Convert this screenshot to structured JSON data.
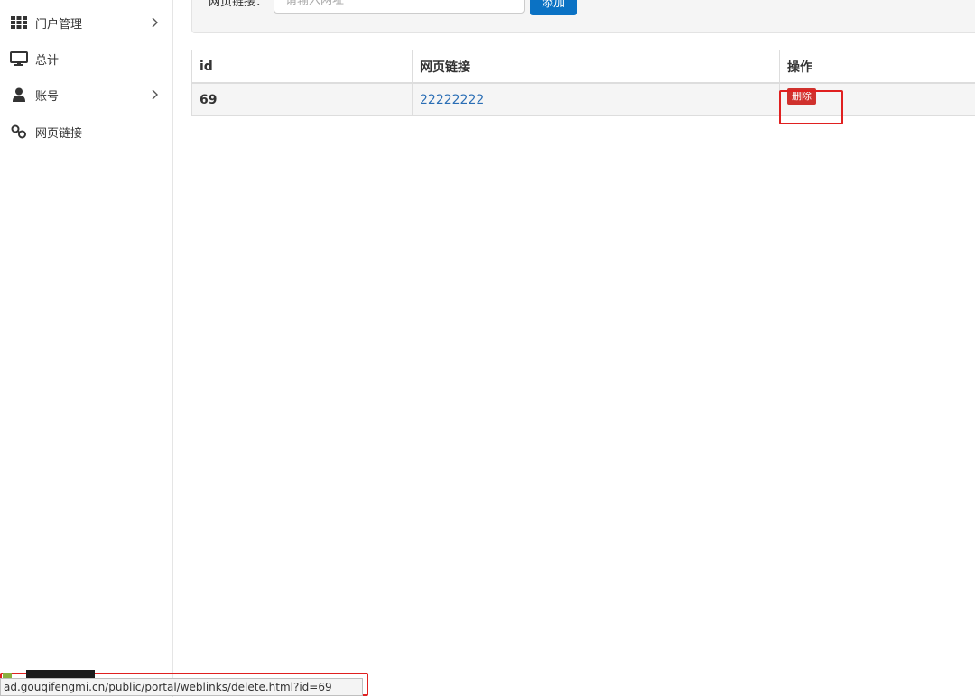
{
  "sidebar": {
    "items": [
      {
        "label": "门户管理",
        "icon": "grid-icon",
        "has_chevron": true
      },
      {
        "label": "总计",
        "icon": "monitor-icon",
        "has_chevron": false
      },
      {
        "label": "账号",
        "icon": "user-icon",
        "has_chevron": true
      },
      {
        "label": "网页链接",
        "icon": "link-icon",
        "has_chevron": false
      }
    ]
  },
  "form": {
    "label": "网页链接：",
    "input_placeholder": "请输入网址",
    "add_label": "添加"
  },
  "table": {
    "headers": [
      "id",
      "网页链接",
      "操作"
    ],
    "rows": [
      {
        "id": "69",
        "link": "22222222",
        "action_label": "删除"
      }
    ]
  },
  "status_bar": {
    "url": "ad.gouqifengmi.cn/public/portal/weblinks/delete.html?id=69"
  },
  "colors": {
    "primary_button": "#0b72c4",
    "delete_button": "#d0312d",
    "link": "#2a6eb5",
    "highlight": "#e02020"
  }
}
